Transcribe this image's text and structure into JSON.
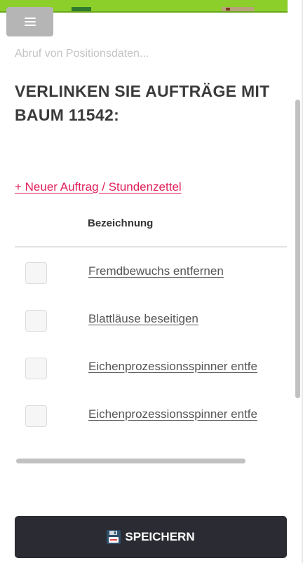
{
  "status_text": "Abruf von Positionsdaten...",
  "title": "VERLINKEN SIE AUFTRÄGE MIT BAUM 11542:",
  "new_order_link": "+ Neuer Auftrag / Stundenzettel",
  "table": {
    "column_header": "Bezeichnung",
    "rows": [
      {
        "label": "Fremdbewuchs entfernen",
        "checked": false
      },
      {
        "label": "Blattläuse beseitigen",
        "checked": false
      },
      {
        "label": "Eichenprozessionsspinner entfe",
        "checked": false
      },
      {
        "label": "Eichenprozessionsspinner entfe",
        "checked": false
      }
    ]
  },
  "save_button": {
    "label": "SPEICHERN",
    "icon": "floppy-disk-icon"
  },
  "menu_button": {
    "icon": "hamburger-menu-icon"
  },
  "colors": {
    "accent_link": "#e0205a",
    "top_bar": "#8ccf2b",
    "save_button_bg": "#2b2b33",
    "menu_button_bg": "#b5b5b5"
  }
}
